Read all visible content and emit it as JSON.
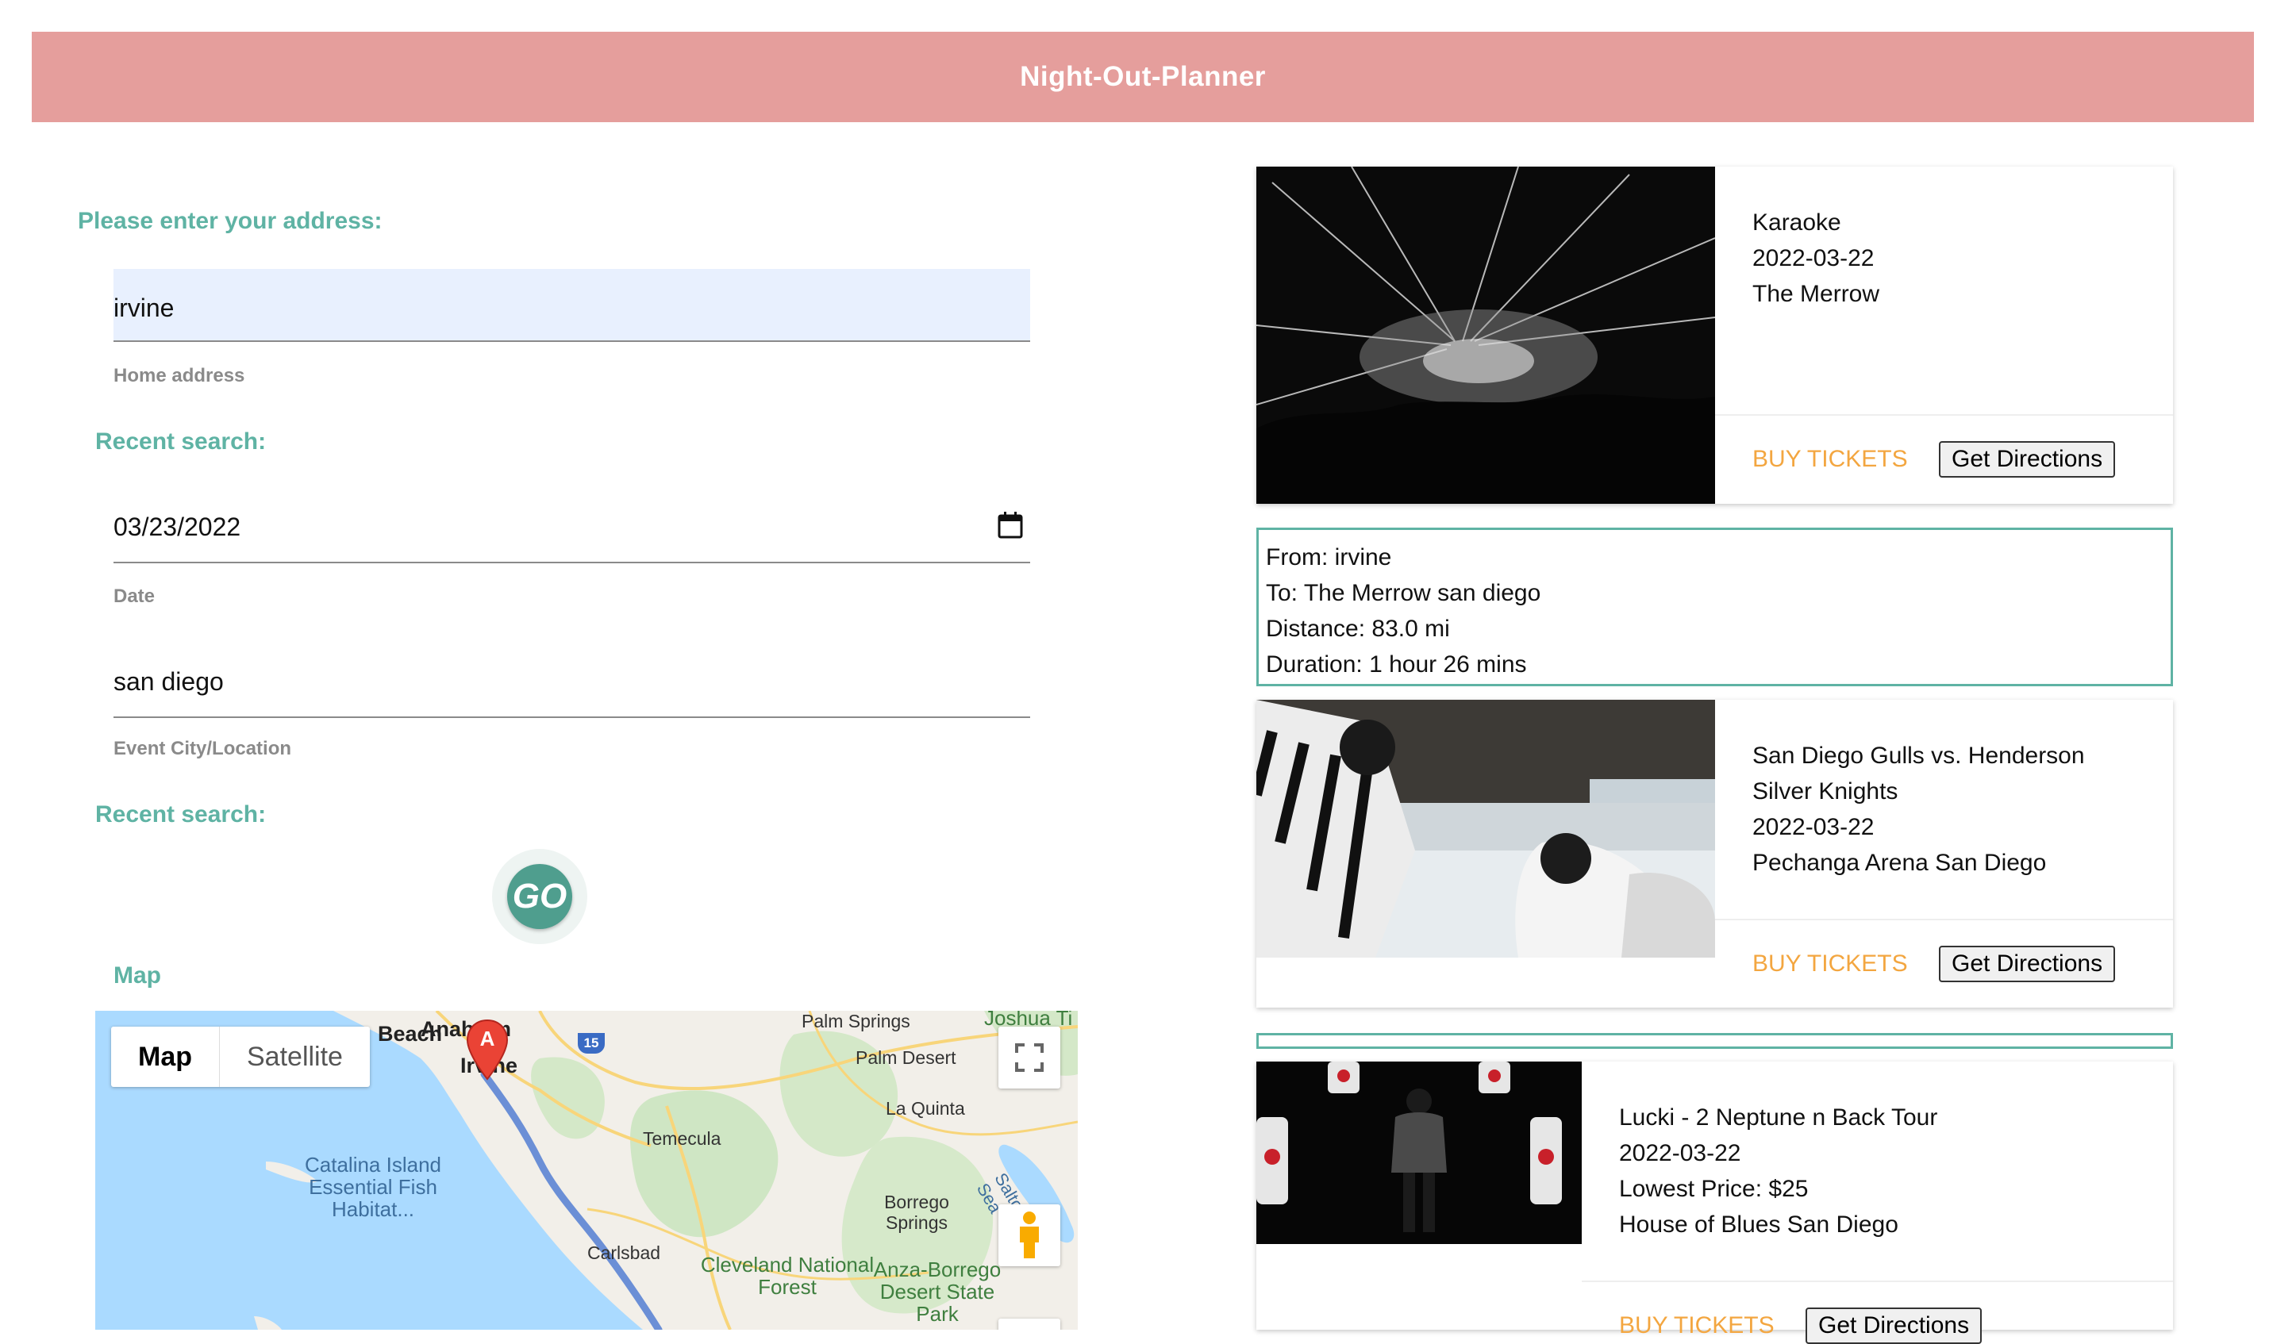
{
  "header": {
    "title": "Night-Out-Planner"
  },
  "form": {
    "address_prompt": "Please enter your address:",
    "address_value": "irvine",
    "address_helper": "Home address",
    "recent_search_1": "Recent search:",
    "date_value": "03/23/2022",
    "date_helper": "Date",
    "city_value": "san diego",
    "city_helper": "Event City/Location",
    "recent_search_2": "Recent search:",
    "go_label": "GO"
  },
  "map": {
    "section_label": "Map",
    "tab_map": "Map",
    "tab_satellite": "Satellite",
    "marker_label": "A",
    "places": {
      "beach": "Beach",
      "anaheim": "Anaheim",
      "irvine": "Irvine",
      "palm_springs": "Palm Springs",
      "palm_desert": "Palm Desert",
      "la_quinta": "La Quinta",
      "joshua": "Joshua Ti",
      "temecula": "Temecula",
      "catalina": "Catalina Island Essential Fish Habitat...",
      "borrego": "Borrego Springs",
      "carlsbad": "Carlsbad",
      "cleveland": "Cleveland National Forest",
      "anza": "Anza-Borrego Desert State Park",
      "salton": "Salton Sea",
      "route_15": "15"
    }
  },
  "events": [
    {
      "name": "Karaoke",
      "date": "2022-03-22",
      "venue": "The Merrow",
      "buy_label": "BUY TICKETS",
      "directions_label": "Get Directions"
    },
    {
      "name_line1": "San Diego Gulls vs. Henderson",
      "name_line2": "Silver Knights",
      "date": "2022-03-22",
      "venue": "Pechanga Arena San Diego",
      "buy_label": "BUY TICKETS",
      "directions_label": "Get Directions"
    },
    {
      "name": "Lucki - 2 Neptune n Back Tour",
      "date": "2022-03-22",
      "price": "Lowest Price: $25",
      "venue": "House of Blues San Diego",
      "buy_label": "BUY TICKETS",
      "directions_label": "Get Directions"
    }
  ],
  "route": {
    "from": "From: irvine",
    "to": "To: The Merrow san diego",
    "distance": "Distance: 83.0 mi",
    "duration": "Duration: 1 hour 26 mins"
  },
  "colors": {
    "header": "#e59e9c",
    "teal": "#5fb3a4",
    "buy": "#f3a640",
    "input_fill": "#e8f0fe"
  }
}
